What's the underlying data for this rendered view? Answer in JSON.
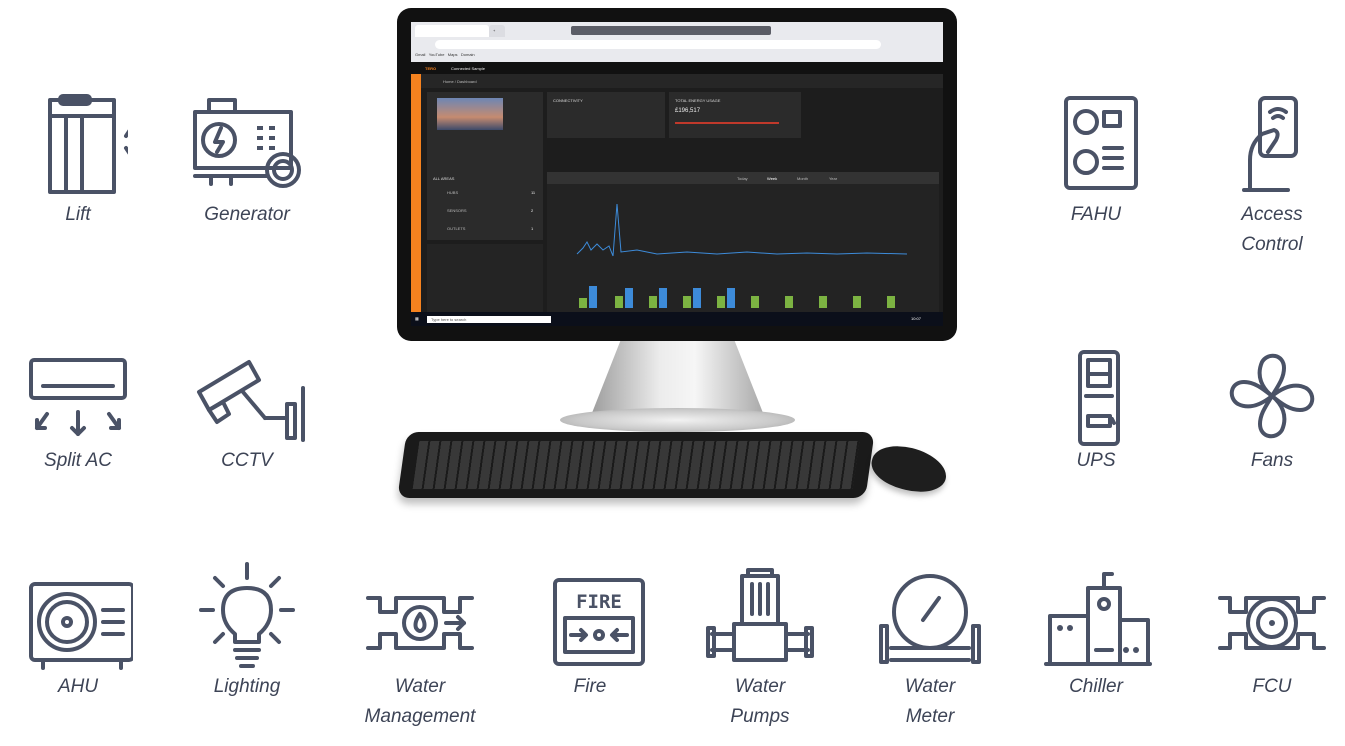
{
  "devices": {
    "lift": "Lift",
    "generator": "Generator",
    "fahu": "FAHU",
    "access_control": [
      "Access",
      "Control"
    ],
    "split_ac": "Split AC",
    "cctv": "CCTV",
    "ups": "UPS",
    "fans": "Fans",
    "ahu": "AHU",
    "lighting": "Lighting",
    "water_management": [
      "Water",
      "Management"
    ],
    "fire": "Fire",
    "water_pumps": [
      "Water",
      "Pumps"
    ],
    "water_meter": [
      "Water",
      "Meter"
    ],
    "chiller": "Chiller",
    "fcu": "FCU"
  },
  "icon_text": {
    "fire": "FIRE"
  },
  "colors": {
    "icon": "#4a5266",
    "accent": "#f5821f"
  },
  "screen": {
    "app_title": "Connected Sample",
    "breadcrumb": "Home / Dashboard",
    "connectivity_title": "CONNECTIVITY",
    "energy_title": "TOTAL ENERGY USAGE",
    "energy_value": "£196,517",
    "all_areas": "ALL AREAS",
    "rows": [
      "HUBS",
      "SENSORS",
      "OUTLETS"
    ],
    "counts": [
      "11",
      "2",
      "1"
    ],
    "tabs": [
      "Today",
      "Week",
      "Month",
      "Year"
    ],
    "search_placeholder": "Type here to search",
    "time": "10:07"
  }
}
